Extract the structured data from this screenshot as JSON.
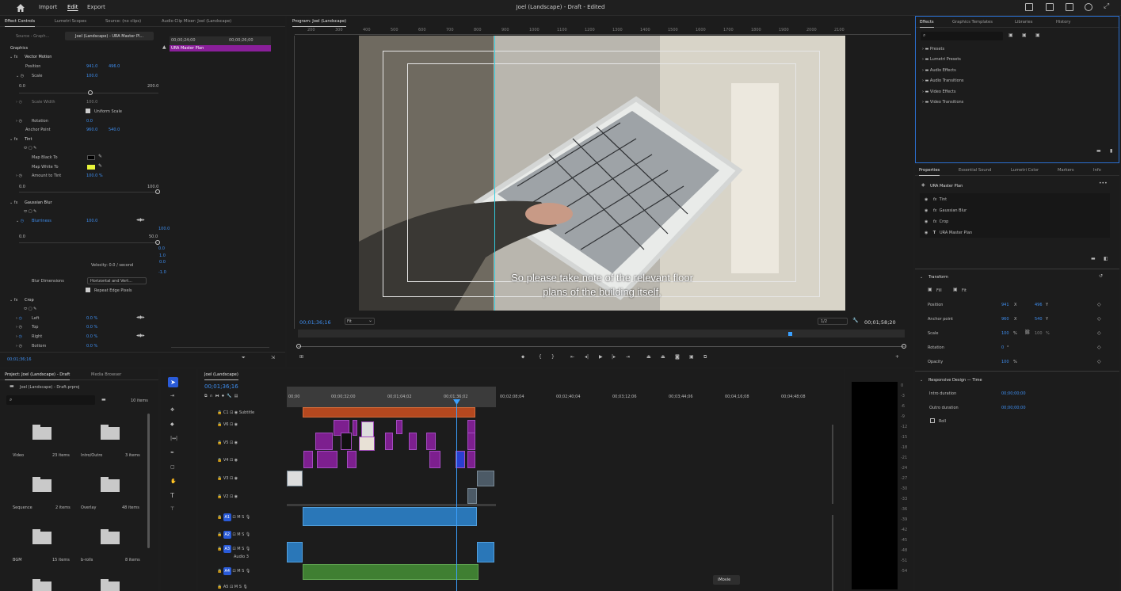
{
  "topbar": {
    "menus": [
      "Import",
      "Edit",
      "Export"
    ],
    "active_menu": "Edit",
    "title": "Joel (Landscape) - Draft - Edited"
  },
  "effect_controls": {
    "tabs": [
      "Effect Controls",
      "Lumetri Scopes",
      "Source: (no clips)",
      "Audio Clip Mixer: Joel (Landscape)"
    ],
    "source_label": "Source - Graph...",
    "sequence_label": "Joel (Landscape) - URA Master Pl...",
    "timecode_start": "00;00;24;00",
    "timecode_end": "00;00;26;00",
    "clip_name": "URA Master Plan",
    "section": "Graphics",
    "vector_motion": "Vector Motion",
    "position_label": "Position",
    "position_x": "941.0",
    "position_y": "496.0",
    "scale_label": "Scale",
    "scale_value": "100.0",
    "slider_min": "0.0",
    "slider_max": "200.0",
    "scale_width_label": "Scale Width",
    "scale_width_value": "100.0",
    "uniform_scale": "Uniform Scale",
    "rotation_label": "Rotation",
    "rotation_value": "0.0",
    "anchor_label": "Anchor Point",
    "anchor_x": "960.0",
    "anchor_y": "540.0",
    "tint": "Tint",
    "map_black": "Map Black To",
    "map_white": "Map White To",
    "amount_tint": "Amount to Tint",
    "amount_value": "100.0 %",
    "amount_min": "0.0",
    "amount_max": "100.0",
    "gaussian": "Gaussian Blur",
    "blurriness": "Blurriness",
    "blur_value": "100.0",
    "blur_min": "0.0",
    "blur_max": "50.0",
    "graph_top": "100.0",
    "graph_mid": "0.0",
    "graph_a": "1.0",
    "graph_b": "0.0",
    "graph_c": "-1.0",
    "velocity": "Velocity: 0.0 / second",
    "blur_dims": "Blur Dimensions",
    "blur_dims_value": "Horizontal and Vert...",
    "repeat_edge": "Repeat Edge Pixels",
    "crop": "Crop",
    "left": "Left",
    "top": "Top",
    "right": "Right",
    "bottom": "Bottom",
    "crop_value": "0.0 %",
    "footer_time": "00;01;36;16"
  },
  "program": {
    "title": "Program: Joel (Landscape)",
    "ruler": [
      "200",
      "300",
      "400",
      "500",
      "600",
      "700",
      "800",
      "900",
      "1000",
      "1100",
      "1200",
      "1300",
      "1400",
      "1500",
      "1600",
      "1700",
      "1800",
      "1900",
      "2000",
      "2100"
    ],
    "subtitle_line1": "So please take note of the relevant floor",
    "subtitle_line2": "plans of the building itself,",
    "timecode": "00;01;36;16",
    "fit": "Fit",
    "resolution": "1/2",
    "duration": "00;01;58;20"
  },
  "effects": {
    "tabs": [
      "Effects",
      "Graphics Templates",
      "Libraries",
      "History"
    ],
    "folders": [
      "Presets",
      "Lumetri Presets",
      "Audio Effects",
      "Audio Transitions",
      "Video Effects",
      "Video Transitions"
    ]
  },
  "properties": {
    "tabs": [
      "Properties",
      "Essential Sound",
      "Lumetri Color",
      "Markers",
      "Info"
    ],
    "clip": "URA Master Plan",
    "layers": [
      "Tint",
      "Gaussian Blur",
      "Crop",
      "URA Master Plan"
    ],
    "transform": "Transform",
    "fill": "Fill",
    "fit": "Fit",
    "position": "Position",
    "position_x": "941",
    "position_y": "496",
    "anchor": "Anchor point",
    "anchor_x": "960",
    "anchor_y": "540",
    "scale": "Scale",
    "scale_value": "100",
    "scale_value2": "100",
    "rotation": "Rotation",
    "rotation_value": "0",
    "opacity": "Opacity",
    "opacity_value": "100",
    "responsive": "Responsive Design — Time",
    "intro": "Intro duration",
    "intro_value": "00;00;00;00",
    "outro": "Outro duration",
    "outro_value": "00;00;00;00",
    "roll": "Roll"
  },
  "project": {
    "tabs": [
      "Project: Joel (Landscape) - Draft",
      "Media Browser"
    ],
    "file": "Joel (Landscape) - Draft.prproj",
    "count": "10 items",
    "bins": [
      {
        "name": "Video",
        "items": "23 items"
      },
      {
        "name": "Intro/Outro",
        "items": "3 items"
      },
      {
        "name": "Sequence",
        "items": "2 items"
      },
      {
        "name": "Overlay",
        "items": "48 items"
      },
      {
        "name": "BGM",
        "items": "15 items"
      },
      {
        "name": "b-rolls",
        "items": "8 items"
      }
    ]
  },
  "timeline": {
    "tab": "Joel (Landscape)",
    "timecode": "00;01;36;16",
    "ruler": [
      "00;00",
      "00;00;32;00",
      "00;01;04;02",
      "00;01;36;02",
      "00;02;08;04",
      "00;02;40;04",
      "00;03;12;06",
      "00;03;44;06",
      "00;04;16;08",
      "00;04;48;08"
    ],
    "video_tracks": [
      {
        "id": "C1",
        "name": "Subtitle"
      },
      {
        "id": "V6",
        "name": ""
      },
      {
        "id": "V5",
        "name": ""
      },
      {
        "id": "V4",
        "name": ""
      },
      {
        "id": "V3",
        "name": ""
      },
      {
        "id": "V2",
        "name": ""
      }
    ],
    "audio_tracks": [
      {
        "id": "A1",
        "name": ""
      },
      {
        "id": "A2",
        "name": ""
      },
      {
        "id": "A3",
        "name": "Audio 3"
      },
      {
        "id": "A4",
        "name": ""
      },
      {
        "id": "A5",
        "name": ""
      }
    ],
    "meter": [
      "0",
      "-3",
      "-6",
      "-9",
      "-12",
      "-15",
      "-18",
      "-21",
      "-24",
      "-27",
      "-30",
      "-33",
      "-36",
      "-39",
      "-42",
      "-45",
      "-48",
      "-51",
      "-54"
    ],
    "tooltip": "iMovie"
  },
  "colors": {
    "accent": "#3aa0ff",
    "purple_clip": "#7d1f8f",
    "subtitle_clip": "#b4481f",
    "audio_clip": "#2a77b8",
    "music_clip": "#3f7f32"
  }
}
